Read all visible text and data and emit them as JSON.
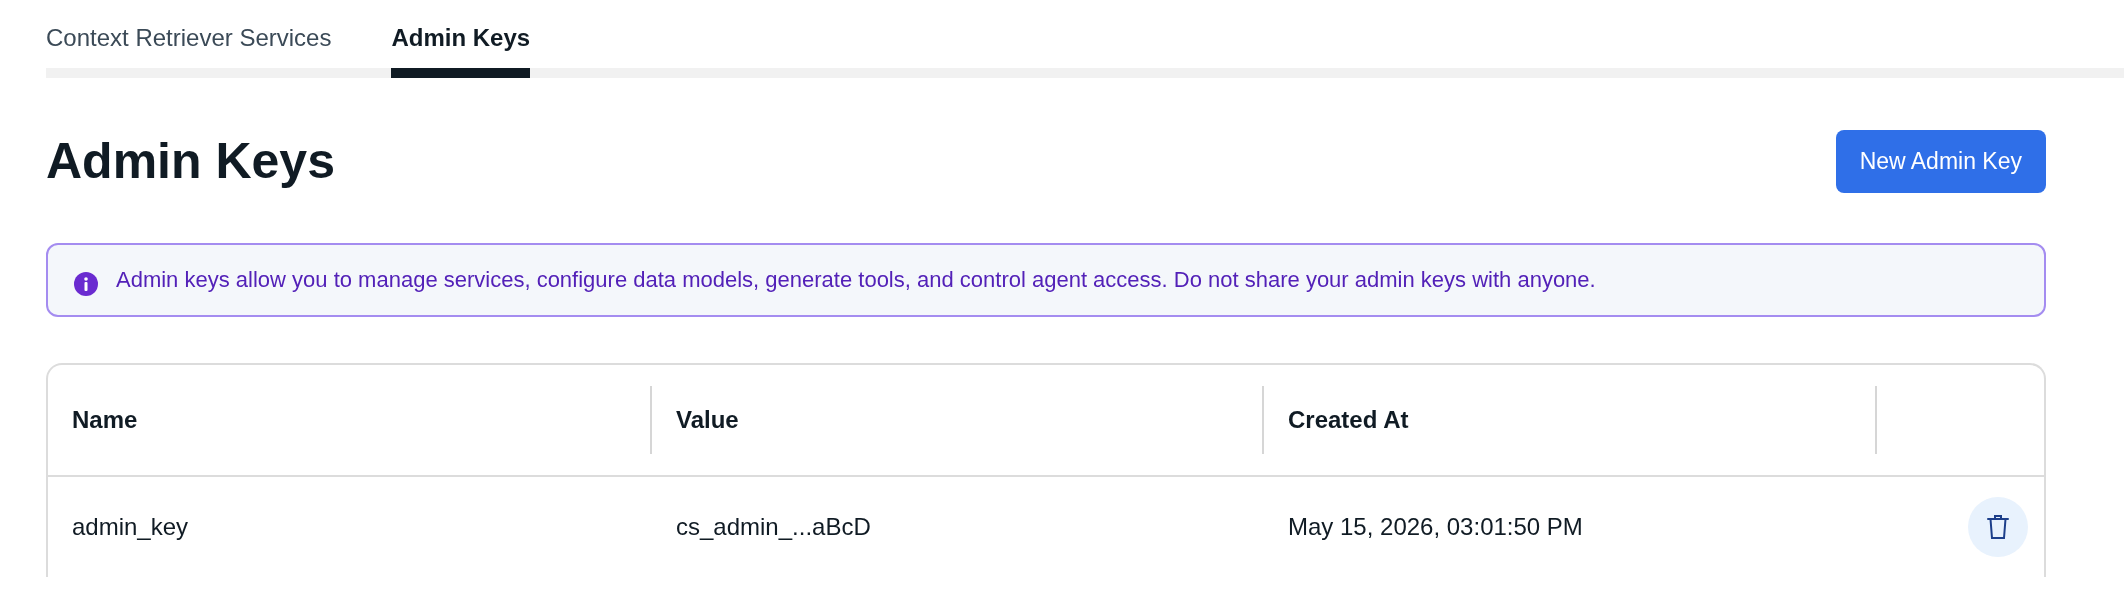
{
  "tabs": [
    {
      "label": "Context Retriever Services",
      "selected": false
    },
    {
      "label": "Admin Keys",
      "selected": true
    }
  ],
  "page_title": "Admin Keys",
  "new_button": "New Admin Key",
  "alert": {
    "text": "Admin keys allow you to manage services, configure data models, generate tools, and control agent access. Do not share your admin keys with anyone."
  },
  "table": {
    "columns": [
      "Name",
      "Value",
      "Created At"
    ],
    "rows": [
      {
        "name": "admin_key",
        "value": "cs_admin_...aBcD",
        "created_at": "May 15, 2026, 03:01:50 PM"
      }
    ]
  }
}
